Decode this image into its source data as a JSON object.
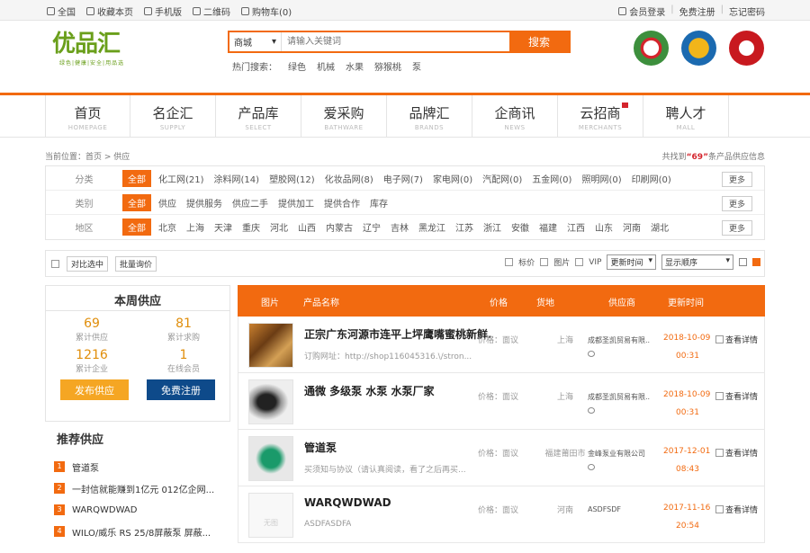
{
  "topbar": {
    "left": [
      "全国",
      "收藏本页",
      "手机版",
      "二维码",
      "购物车(0)"
    ],
    "right": [
      "会员登录",
      "免费注册",
      "忘记密码"
    ]
  },
  "logo": {
    "text": "优品汇",
    "sub": "绿色|健康|安全|用品选"
  },
  "search": {
    "category": "商城",
    "placeholder": "请输入关键词",
    "button": "搜索"
  },
  "hot": {
    "label": "热门搜索：",
    "items": [
      "绿色",
      "机械",
      "水果",
      "猕猴桃",
      "泵"
    ]
  },
  "nav": [
    {
      "cn": "首页",
      "en": "HOMEPAGE"
    },
    {
      "cn": "名企汇",
      "en": "SUPPLY"
    },
    {
      "cn": "产品库",
      "en": "SELECT"
    },
    {
      "cn": "爱采购",
      "en": "BATHWARE"
    },
    {
      "cn": "品牌汇",
      "en": "BRANDS"
    },
    {
      "cn": "企商讯",
      "en": "NEWS"
    },
    {
      "cn": "云招商",
      "en": "MERCHANTS"
    },
    {
      "cn": "聘人才",
      "en": "MALL"
    }
  ],
  "breadcrumb": "当前位置：首页 > 供应",
  "found": {
    "prefix": "共找到",
    "count": "“69”",
    "suffix": "条产品供应信息"
  },
  "filters": [
    {
      "label": "分类",
      "all": "全部",
      "more": "更多",
      "options": [
        "化工网(21)",
        "涂料网(14)",
        "塑胶网(12)",
        "化妆品网(8)",
        "电子网(7)",
        "家电网(0)",
        "汽配网(0)",
        "五金网(0)",
        "照明网(0)",
        "印刷网(0)"
      ]
    },
    {
      "label": "类别",
      "all": "全部",
      "more": "更多",
      "options": [
        "供应",
        "提供服务",
        "供应二手",
        "提供加工",
        "提供合作",
        "库存"
      ]
    },
    {
      "label": "地区",
      "all": "全部",
      "more": "更多",
      "options": [
        "北京",
        "上海",
        "天津",
        "重庆",
        "河北",
        "山西",
        "内蒙古",
        "辽宁",
        "吉林",
        "黑龙江",
        "江苏",
        "浙江",
        "安徽",
        "福建",
        "江西",
        "山东",
        "河南",
        "湖北"
      ]
    }
  ],
  "toolbar": {
    "compare": "对比选中",
    "inquiry": "批量询价",
    "checks": [
      "标价",
      "图片",
      "VIP"
    ],
    "sort1": "更新时间",
    "sort2": "显示顺序"
  },
  "week": {
    "title": "本周供应",
    "stats": [
      {
        "n": "69",
        "l": "累计供应"
      },
      {
        "n": "81",
        "l": "累计求购"
      },
      {
        "n": "1216",
        "l": "累计企业"
      },
      {
        "n": "1",
        "l": "在线会员"
      }
    ],
    "publish": "发布供应",
    "register": "免费注册"
  },
  "recommend": {
    "title": "推荐供应",
    "items": [
      "管道泵",
      "一封信就能赚到1亿元 012亿企网...",
      "WARQWDWAD",
      "WILO/威乐 RS 25/8屏蔽泵 屏蔽..."
    ]
  },
  "table": {
    "headers": [
      "图片",
      "产品名称",
      "价格",
      "货地",
      "供应商",
      "更新时间"
    ],
    "rows": [
      {
        "name": "正宗广东河源市连平上坪鹰嘴蜜桃新鲜...",
        "desc": "订购网址：http://shop116045316.\\/stron...",
        "price": "价格：面议",
        "loc": "上海",
        "company": "成都圣凯贸易有限...",
        "date": "2018-10-09",
        "time": "00:31",
        "detail": "查看详情"
      },
      {
        "name": "通微 多级泵 水泵 水泵厂家",
        "desc": "",
        "price": "价格：面议",
        "loc": "上海",
        "company": "成都圣凯贸易有限...",
        "date": "2018-10-09",
        "time": "00:31",
        "detail": "查看详情"
      },
      {
        "name": "管道泵",
        "desc": "买须知与协议（请认真阅读，看了之后再买...",
        "price": "价格：面议",
        "loc": "福建莆田市",
        "company": "金峰泵业有限公司",
        "date": "2017-12-01",
        "time": "08:43",
        "detail": "查看详情"
      },
      {
        "name": "WARQWDWAD",
        "desc": "ASDFASDFA",
        "price": "价格：面议",
        "loc": "河南",
        "company": "ASDFSDF",
        "date": "2017-11-16",
        "time": "20:54",
        "detail": "查看详情"
      }
    ]
  }
}
